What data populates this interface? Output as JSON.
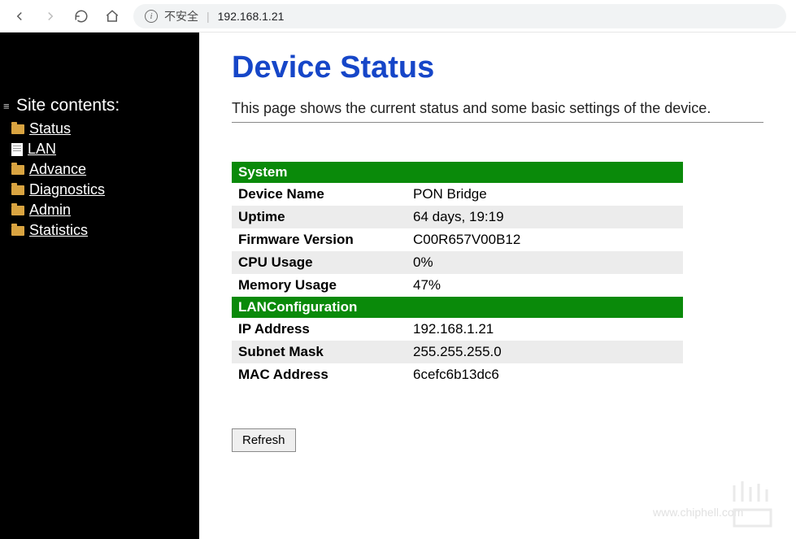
{
  "browser": {
    "security_label": "不安全",
    "url": "192.168.1.21"
  },
  "sidebar": {
    "title": "Site contents:",
    "items": [
      {
        "label": "Status",
        "icon": "folder"
      },
      {
        "label": "LAN",
        "icon": "doc"
      },
      {
        "label": "Advance",
        "icon": "folder"
      },
      {
        "label": "Diagnostics",
        "icon": "folder"
      },
      {
        "label": "Admin",
        "icon": "folder"
      },
      {
        "label": "Statistics",
        "icon": "folder"
      }
    ]
  },
  "main": {
    "title": "Device Status",
    "description": "This page shows the current status and some basic settings of the device.",
    "sections": [
      {
        "header": "System",
        "rows": [
          {
            "label": "Device Name",
            "value": "PON Bridge"
          },
          {
            "label": "Uptime",
            "value": "64 days, 19:19"
          },
          {
            "label": "Firmware Version",
            "value": "C00R657V00B12"
          },
          {
            "label": "CPU Usage",
            "value": "0%"
          },
          {
            "label": "Memory Usage",
            "value": "47%"
          }
        ]
      },
      {
        "header": "LANConfiguration",
        "rows": [
          {
            "label": "IP Address",
            "value": "192.168.1.21"
          },
          {
            "label": "Subnet Mask",
            "value": "255.255.255.0"
          },
          {
            "label": "MAC Address",
            "value": "6cefc6b13dc6"
          }
        ]
      }
    ],
    "refresh_label": "Refresh"
  },
  "watermark": "www.chiphell.com"
}
